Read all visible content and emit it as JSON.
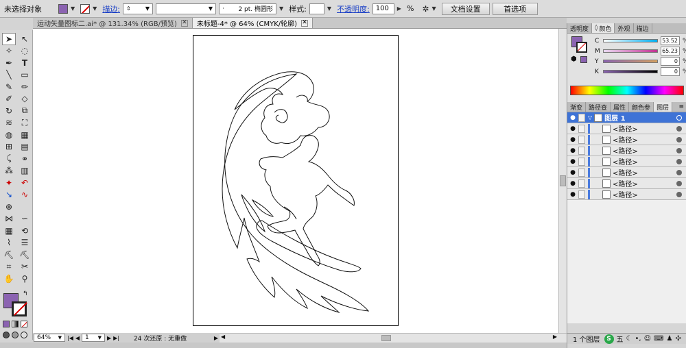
{
  "control_bar": {
    "no_selection": "未选择对象",
    "fill_color": "#8b63b1",
    "stroke_label": "描边:",
    "brush_value": "2 pt. 椭圆形",
    "style_label": "样式:",
    "opacity_label": "不透明度:",
    "opacity_value": "100",
    "opacity_unit": "%",
    "doc_setup": "文档设置",
    "preferences": "首选项"
  },
  "tabs": [
    {
      "label": "运动矢量图标二.ai* @ 131.34% (RGB/预览)",
      "close": "✕"
    },
    {
      "label": "未标题-4* @ 64% (CMYK/轮廓)",
      "close": "✕"
    }
  ],
  "status_bar": {
    "zoom": "64%",
    "page": "1",
    "undo_text": "24 次还原 : 无重做"
  },
  "color_panel": {
    "tabs": [
      "透明度",
      "颜色",
      "外观",
      "描边"
    ],
    "channels": [
      {
        "label": "C",
        "value": "53.52",
        "unit": "%"
      },
      {
        "label": "M",
        "value": "65.23",
        "unit": "%"
      },
      {
        "label": "Y",
        "value": "0",
        "unit": "%"
      },
      {
        "label": "K",
        "value": "0",
        "unit": "%"
      }
    ]
  },
  "layers_panel": {
    "tabs": [
      "渐变",
      "路径查",
      "属性",
      "颜色参",
      "图层"
    ],
    "layer_name": "图层 1",
    "items": [
      "<路径>",
      "<路径>",
      "<路径>",
      "<路径>",
      "<路径>",
      "<路径>",
      "<路径>"
    ],
    "footer": "1 个图层"
  },
  "taskbar": {
    "ime": "五"
  }
}
